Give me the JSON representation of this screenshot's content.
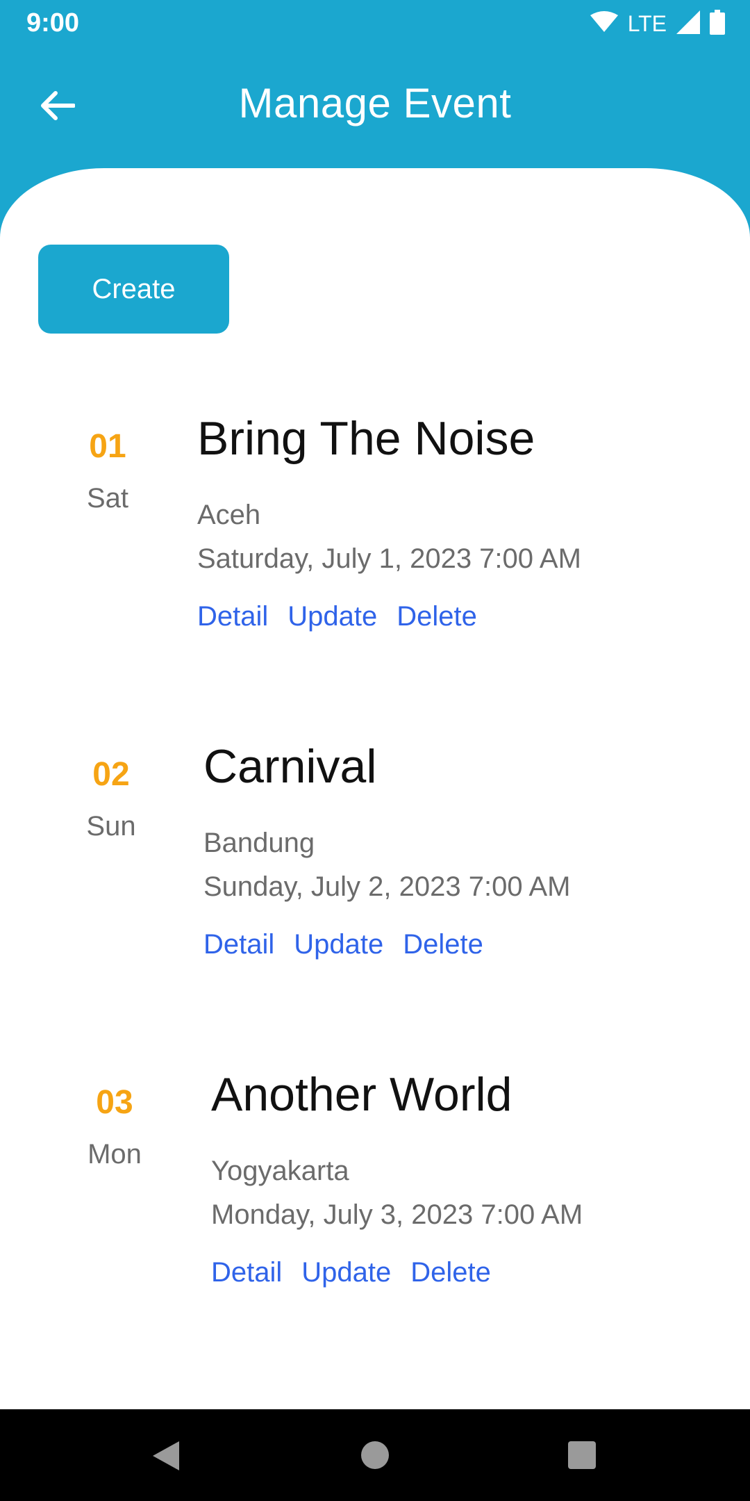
{
  "status_bar": {
    "time": "9:00",
    "network": "LTE"
  },
  "app_bar": {
    "title": "Manage Event"
  },
  "actions": {
    "create_label": "Create"
  },
  "events": [
    {
      "day_number": "01",
      "day_name": "Sat",
      "title": "Bring The Noise",
      "location": "Aceh",
      "datetime": "Saturday, July 1, 2023 7:00 AM",
      "detail_label": "Detail",
      "update_label": "Update",
      "delete_label": "Delete"
    },
    {
      "day_number": "02",
      "day_name": "Sun",
      "title": "Carnival",
      "location": "Bandung",
      "datetime": "Sunday, July 2, 2023 7:00 AM",
      "detail_label": "Detail",
      "update_label": "Update",
      "delete_label": "Delete"
    },
    {
      "day_number": "03",
      "day_name": "Mon",
      "title": "Another World",
      "location": "Yogyakarta",
      "datetime": "Monday, July 3, 2023 7:00 AM",
      "detail_label": "Detail",
      "update_label": "Update",
      "delete_label": "Delete"
    }
  ],
  "colors": {
    "primary": "#1ba7cf",
    "accent": "#f6a414",
    "link": "#2f63e9",
    "muted_text": "#6b6b6b"
  }
}
